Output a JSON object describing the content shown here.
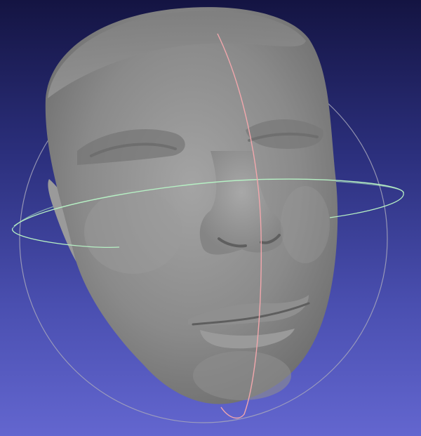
{
  "viewer": {
    "background_top": "#141442",
    "background_bottom": "#6366cf"
  },
  "mesh": {
    "subject": "3d-face-scan",
    "shading_color": "#8d8d8d"
  },
  "trackball": {
    "horizontal_ring_color": "#b6f0c4",
    "vertical_ring_color": "#f2a7ac",
    "outer_ring_color": "#a6a6bb"
  }
}
